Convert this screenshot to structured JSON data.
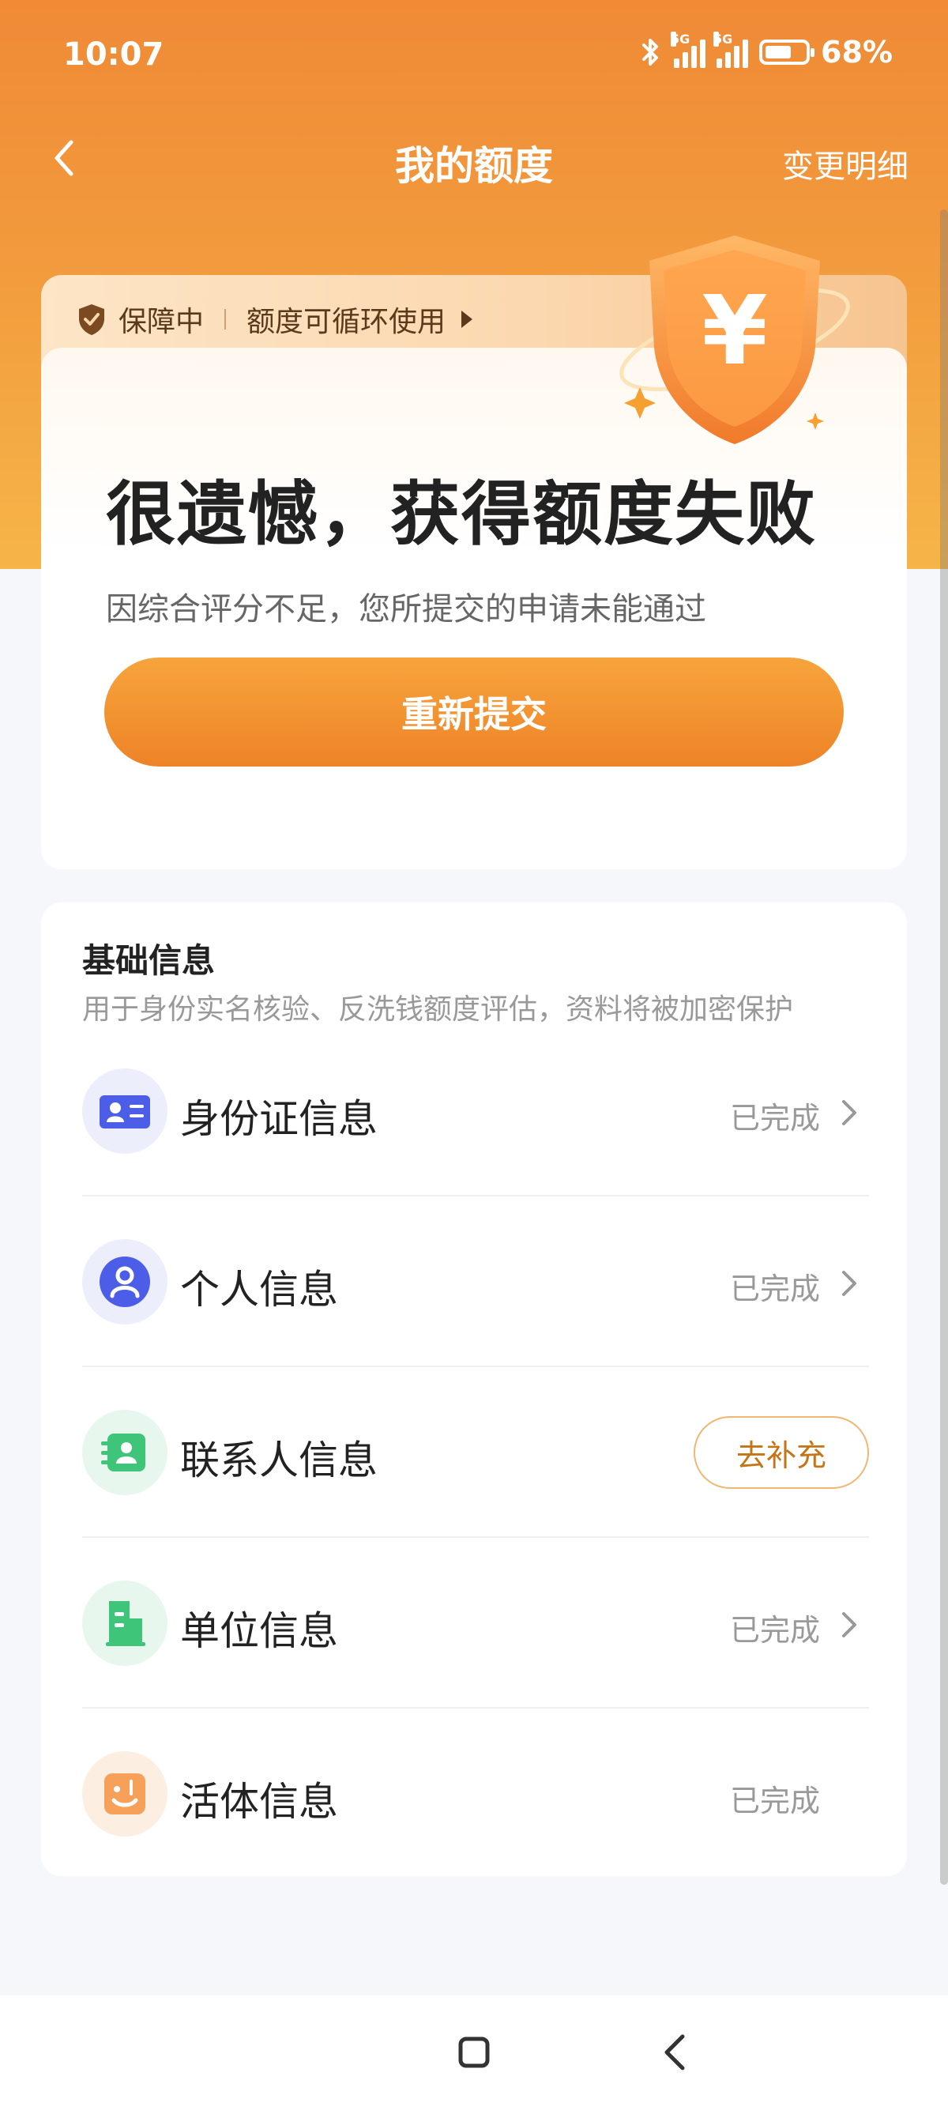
{
  "status_bar": {
    "time": "10:07",
    "network_1": "5G",
    "network_2": "5G",
    "battery": "68%"
  },
  "nav": {
    "title": "我的额度",
    "right_link": "变更明细"
  },
  "guard_banner": {
    "status": "保障中",
    "text": "额度可循环使用"
  },
  "result": {
    "title": "很遗憾，获得额度失败",
    "description": "因综合评分不足，您所提交的申请未能通过",
    "button_label": "重新提交"
  },
  "basic_info": {
    "title": "基础信息",
    "subtitle": "用于身份实名核验、反洗钱额度评估，资料将被加密保护",
    "items": [
      {
        "label": "身份证信息",
        "status": "已完成",
        "icon": "id-card-icon",
        "icon_bg": "#eceefc"
      },
      {
        "label": "个人信息",
        "status": "已完成",
        "icon": "person-icon",
        "icon_bg": "#eceefc"
      },
      {
        "label": "联系人信息",
        "action": "去补充",
        "icon": "contacts-icon",
        "icon_bg": "#e8f7ee"
      },
      {
        "label": "单位信息",
        "status": "已完成",
        "icon": "building-icon",
        "icon_bg": "#e8f7ee"
      },
      {
        "label": "活体信息",
        "status": "已完成",
        "icon": "face-icon",
        "icon_bg": "#fdeee2"
      }
    ]
  },
  "colors": {
    "brand_orange": "#f08a36",
    "button_orange": "#ee8327",
    "accent_text": "#c57416"
  }
}
